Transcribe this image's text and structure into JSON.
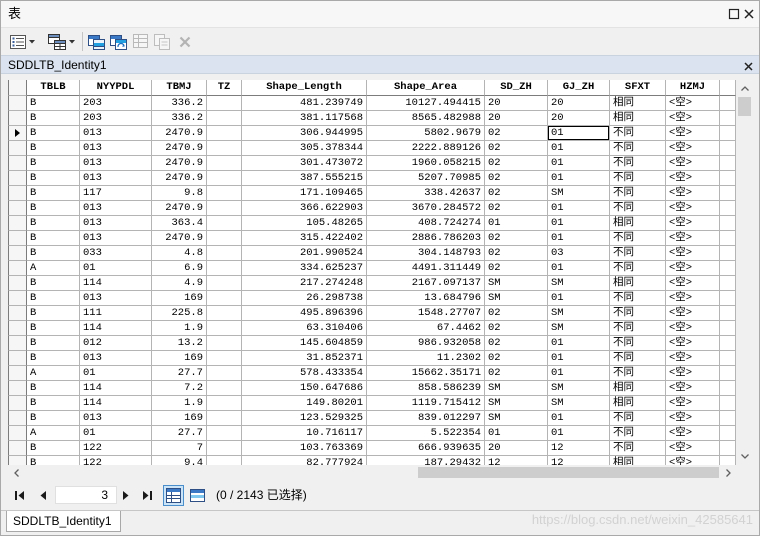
{
  "window": {
    "title": "表"
  },
  "toolbar": {
    "icons": [
      "table-options-icon",
      "related-tables-icon",
      "select-by-attributes-icon",
      "switch-selection-icon",
      "clear-selection-icon",
      "copy-selected-icon",
      "delete-selected-icon"
    ]
  },
  "table_tab": {
    "name": "SDDLTB_Identity1"
  },
  "table": {
    "columns": [
      "TBLB",
      "NYYPDL",
      "TBMJ",
      "TZ",
      "Shape_Length",
      "Shape_Area",
      "SD_ZH",
      "GJ_ZH",
      "SFXT",
      "HZMJ"
    ],
    "current_row": 3,
    "focused_column": "GJ_ZH",
    "rows": [
      [
        "B",
        "203",
        "336.2",
        "",
        "481.239749",
        "10127.494415",
        "20",
        "20",
        "相同",
        "<空>"
      ],
      [
        "B",
        "203",
        "336.2",
        "",
        "381.117568",
        "8565.482988",
        "20",
        "20",
        "相同",
        "<空>"
      ],
      [
        "B",
        "013",
        "2470.9",
        "",
        "306.944995",
        "5802.9679",
        "02",
        "01",
        "不同",
        "<空>"
      ],
      [
        "B",
        "013",
        "2470.9",
        "",
        "305.378344",
        "2222.889126",
        "02",
        "01",
        "不同",
        "<空>"
      ],
      [
        "B",
        "013",
        "2470.9",
        "",
        "301.473072",
        "1960.058215",
        "02",
        "01",
        "不同",
        "<空>"
      ],
      [
        "B",
        "013",
        "2470.9",
        "",
        "387.555215",
        "5207.70985",
        "02",
        "01",
        "不同",
        "<空>"
      ],
      [
        "B",
        "117",
        "9.8",
        "",
        "171.109465",
        "338.42637",
        "02",
        "SM",
        "不同",
        "<空>"
      ],
      [
        "B",
        "013",
        "2470.9",
        "",
        "366.622903",
        "3670.284572",
        "02",
        "01",
        "不同",
        "<空>"
      ],
      [
        "B",
        "013",
        "363.4",
        "",
        "105.48265",
        "408.724274",
        "01",
        "01",
        "相同",
        "<空>"
      ],
      [
        "B",
        "013",
        "2470.9",
        "",
        "315.422402",
        "2886.786203",
        "02",
        "01",
        "不同",
        "<空>"
      ],
      [
        "B",
        "033",
        "4.8",
        "",
        "201.990524",
        "304.148793",
        "02",
        "03",
        "不同",
        "<空>"
      ],
      [
        "A",
        "01",
        "6.9",
        "",
        "334.625237",
        "4491.311449",
        "02",
        "01",
        "不同",
        "<空>"
      ],
      [
        "B",
        "114",
        "4.9",
        "",
        "217.274248",
        "2167.097137",
        "SM",
        "SM",
        "相同",
        "<空>"
      ],
      [
        "B",
        "013",
        "169",
        "",
        "26.298738",
        "13.684796",
        "SM",
        "01",
        "不同",
        "<空>"
      ],
      [
        "B",
        "111",
        "225.8",
        "",
        "495.896396",
        "1548.27707",
        "02",
        "SM",
        "不同",
        "<空>"
      ],
      [
        "B",
        "114",
        "1.9",
        "",
        "63.310406",
        "67.4462",
        "02",
        "SM",
        "不同",
        "<空>"
      ],
      [
        "B",
        "012",
        "13.2",
        "",
        "145.604859",
        "986.932058",
        "02",
        "01",
        "不同",
        "<空>"
      ],
      [
        "B",
        "013",
        "169",
        "",
        "31.852371",
        "11.2302",
        "02",
        "01",
        "不同",
        "<空>"
      ],
      [
        "A",
        "01",
        "27.7",
        "",
        "578.433354",
        "15662.35171",
        "02",
        "01",
        "不同",
        "<空>"
      ],
      [
        "B",
        "114",
        "7.2",
        "",
        "150.647686",
        "858.586239",
        "SM",
        "SM",
        "相同",
        "<空>"
      ],
      [
        "B",
        "114",
        "1.9",
        "",
        "149.80201",
        "1119.715412",
        "SM",
        "SM",
        "相同",
        "<空>"
      ],
      [
        "B",
        "013",
        "169",
        "",
        "123.529325",
        "839.012297",
        "SM",
        "01",
        "不同",
        "<空>"
      ],
      [
        "A",
        "01",
        "27.7",
        "",
        "10.716117",
        "5.522354",
        "01",
        "01",
        "不同",
        "<空>"
      ],
      [
        "B",
        "122",
        "7",
        "",
        "103.763369",
        "666.939635",
        "20",
        "12",
        "不同",
        "<空>"
      ],
      [
        "B",
        "122",
        "9.4",
        "",
        "82.777924",
        "187.29432",
        "12",
        "12",
        "相同",
        "<空>"
      ]
    ]
  },
  "navigation": {
    "current_record": "3",
    "status": "(0 / 2143 已选择)"
  },
  "bottom_tab": {
    "label": "SDDLTB_Identity1"
  },
  "watermark": "https://blog.csdn.net/weixin_42585641",
  "colors": {
    "tab_strip": "#dae3ef",
    "selection_highlight": "#cce4f7",
    "grid_line": "#b4b4b4",
    "watermark": "#d2d2d2"
  }
}
